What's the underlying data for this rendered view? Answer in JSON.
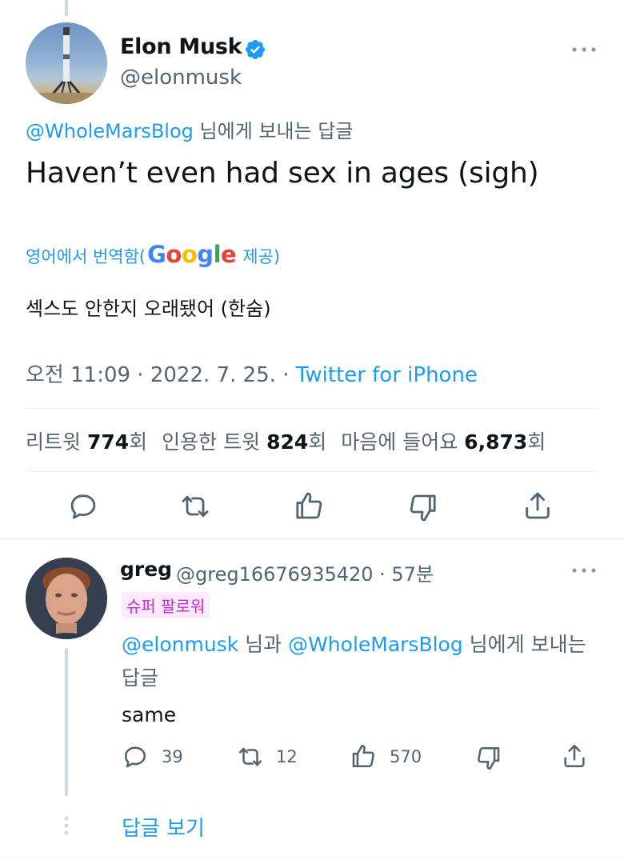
{
  "tweet": {
    "author_name": "Elon Musk",
    "author_handle": "@elonmusk",
    "reply_to_mention": "@WholeMarsBlog",
    "reply_to_suffix": " 님에게 보내는 답글",
    "text": "Haven’t even had sex in ages (sigh)",
    "translate_prefix": "영어에서 번역함(",
    "translate_brand": "Google",
    "translate_suffix": "제공)",
    "translation": "섹스도 안한지 오래됐어 (한숨)",
    "timestamp": "오전 11:09 · 2022. 7. 25. · ",
    "source": "Twitter for iPhone",
    "stats": {
      "retweets_label": "리트윗 ",
      "retweets_count": "774",
      "retweets_unit": "회",
      "quotes_label": "인용한 트윗 ",
      "quotes_count": "824",
      "quotes_unit": "회",
      "likes_label": "마음에 들어요 ",
      "likes_count": "6,873",
      "likes_unit": "회"
    }
  },
  "reply": {
    "author_name": "greg",
    "meta": "@greg16676935420 · 57분",
    "badge": "슈퍼 팔로워",
    "mention_1": "@elonmusk",
    "mid_text": " 님과 ",
    "mention_2": "@WholeMarsBlog",
    "tail_text": " 님에게 보내는 답글",
    "text": "same",
    "counts": {
      "replies": "39",
      "retweets": "12",
      "likes": "570"
    }
  },
  "show_replies": "답글 보기",
  "colors": {
    "accent": "#1d9bf0",
    "text": "#0f1419",
    "muted": "#536471",
    "super_follower": "#c22ccf",
    "divider": "#eff3f4"
  },
  "icons": {
    "verified": "verified-badge-icon",
    "more": "more-dots-icon",
    "reply": "reply-icon",
    "retweet": "retweet-icon",
    "like": "thumbs-up-icon",
    "dislike": "thumbs-down-icon",
    "share": "share-icon"
  }
}
